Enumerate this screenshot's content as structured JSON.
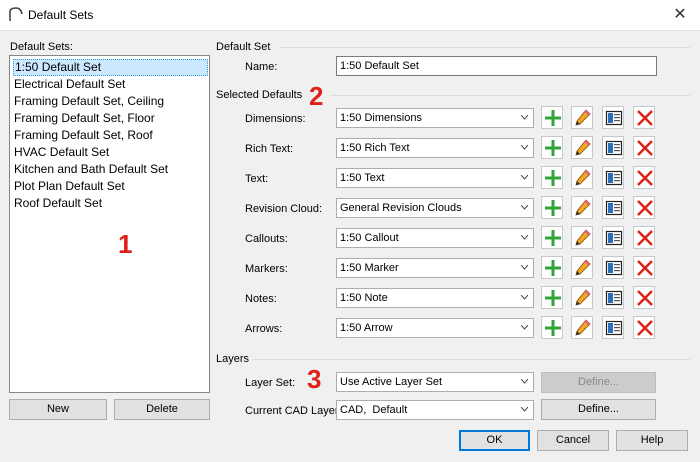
{
  "window": {
    "title": "Default Sets"
  },
  "left_panel": {
    "label": "Default Sets:",
    "items": [
      "1:50 Default Set",
      "Electrical Default Set",
      "Framing Default Set, Ceiling",
      "Framing Default Set, Floor",
      "Framing Default Set, Roof",
      "HVAC Default Set",
      "Kitchen and Bath Default Set",
      "Plot Plan Default Set",
      "Roof Default Set"
    ],
    "selected_index": 0,
    "new_label": "New",
    "delete_label": "Delete"
  },
  "default_set": {
    "group_label": "Default Set",
    "name_label": "Name:",
    "name_value": "1:50 Default Set"
  },
  "selected_defaults": {
    "group_label": "Selected Defaults",
    "rows": [
      {
        "label": "Dimensions:",
        "value": "1:50 Dimensions"
      },
      {
        "label": "Rich Text:",
        "value": "1:50 Rich Text"
      },
      {
        "label": "Text:",
        "value": "1:50 Text"
      },
      {
        "label": "Revision Cloud:",
        "value": "General Revision Clouds"
      },
      {
        "label": "Callouts:",
        "value": "1:50 Callout"
      },
      {
        "label": "Markers:",
        "value": "1:50 Marker"
      },
      {
        "label": "Notes:",
        "value": "1:50 Note"
      },
      {
        "label": "Arrows:",
        "value": "1:50 Arrow"
      }
    ],
    "row_actions": [
      "add-icon",
      "edit-pencil-icon",
      "library-icon",
      "delete-x-icon"
    ]
  },
  "layers": {
    "group_label": "Layers",
    "layer_set_label": "Layer Set:",
    "layer_set_value": "Use Active Layer Set",
    "layer_set_define_label": "Define...",
    "cad_layer_label": "Current CAD Layer:",
    "cad_layer_value": "CAD,  Default",
    "cad_define_label": "Define..."
  },
  "footer": {
    "ok_label": "OK",
    "cancel_label": "Cancel",
    "help_label": "Help"
  },
  "annotations": [
    "1",
    "2",
    "3"
  ],
  "colors": {
    "annotation_red": "#e0201a",
    "selection_blue": "#cce8ff",
    "add_green": "#2fa43a",
    "delete_red": "#d9261c"
  }
}
